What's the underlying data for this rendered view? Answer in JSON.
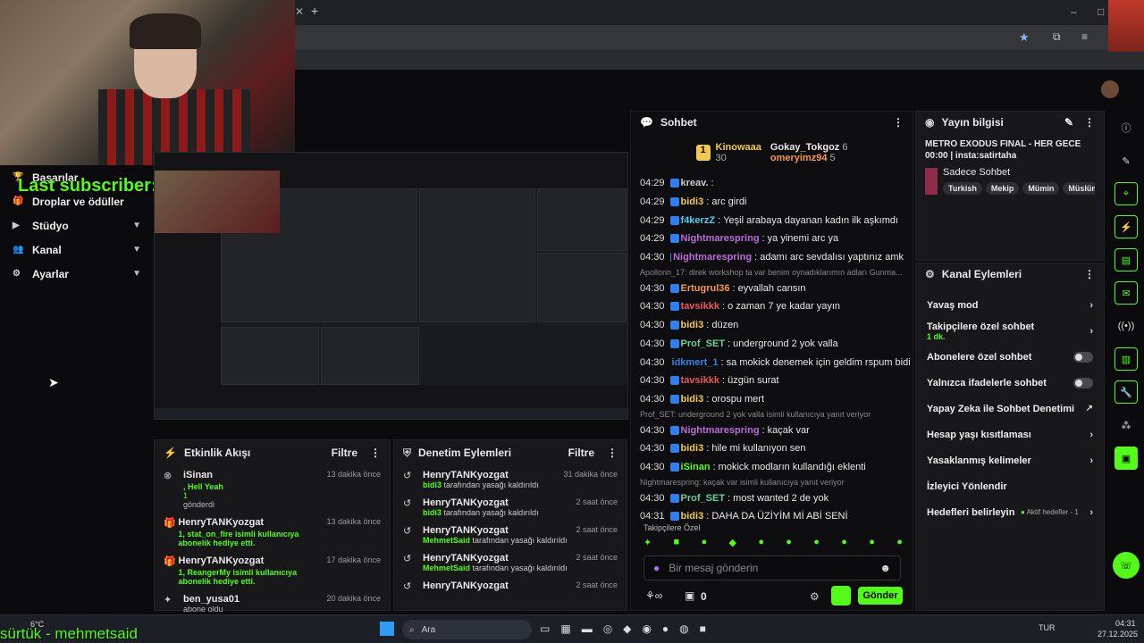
{
  "browser": {
    "new_tab": "+"
  },
  "overlay": {
    "last_subscriber": "Last subscriber: topaipanda",
    "bottom_user": "sürtük - mehmetsaid"
  },
  "leftnav": {
    "items": [
      {
        "label": "Başarılar",
        "icon": "trophy-icon",
        "chev": false
      },
      {
        "label": "Droplar ve ödüller",
        "icon": "gift-icon",
        "chev": false
      },
      {
        "label": "Stüdyo",
        "icon": "video-icon",
        "chev": true
      },
      {
        "label": "Kanal",
        "icon": "users-icon",
        "chev": true
      },
      {
        "label": "Ayarlar",
        "icon": "gear-icon",
        "chev": true
      }
    ]
  },
  "activity": {
    "title": "Etkinlik Akışı",
    "filter": "Filtre",
    "items": [
      {
        "name": "iSinan",
        "sub": ", Hell Yeah",
        "extra": "1",
        "note": "gönderdi",
        "time": "13 dakika önce",
        "icon": "kick-icon"
      },
      {
        "name": "HenryTANKyozgat",
        "sub": "1, stat_on_fire isimli kullanıcıya abonelik hediye etti.",
        "time": "13 dakika önce",
        "icon": "gift-icon"
      },
      {
        "name": "HenryTANKyozgat",
        "sub": "1, ReangerMy isimli kullanıcıya abonelik hediye etti.",
        "time": "17 dakika önce",
        "icon": "gift-icon"
      },
      {
        "name": "ben_yusa01",
        "sub": "abone oldu",
        "time": "20 dakika önce",
        "icon": "star-icon"
      }
    ]
  },
  "moderation": {
    "title": "Denetim Eylemleri",
    "filter": "Filtre",
    "items": [
      {
        "name": "HenryTANKyozgat",
        "actor": "bidi3",
        "text": "tarafından yasağı kaldırıldı",
        "time": "31 dakika önce"
      },
      {
        "name": "HenryTANKyozgat",
        "actor": "bidi3",
        "text": "tarafından yasağı kaldırıldı",
        "time": "2 saat önce"
      },
      {
        "name": "HenryTANKyozgat",
        "actor": "MehmetSaid",
        "text": "tarafından yasağı kaldırıldı",
        "time": "2 saat önce"
      },
      {
        "name": "HenryTANKyozgat",
        "actor": "MehmetSaid",
        "text": "tarafından yasağı kaldırıldı",
        "time": "2 saat önce"
      },
      {
        "name": "HenryTANKyozgat",
        "actor": "",
        "text": "",
        "time": "2 saat önce"
      }
    ]
  },
  "chat": {
    "title": "Sohbet",
    "leaders": [
      {
        "name": "Kinowaaa",
        "count": "30",
        "color": "#f2c94c"
      },
      {
        "name": "Gokay_Tokgoz",
        "count": "6",
        "color": "#ffffff"
      },
      {
        "name": "omeryimz94",
        "count": "5",
        "color": "#f2994a"
      }
    ],
    "messages": [
      {
        "t": "04:29",
        "u": "kreav.",
        "c": "#ccc",
        "m": ""
      },
      {
        "t": "04:29",
        "u": "bidi3",
        "c": "#f2c94c",
        "m": "arc girdi"
      },
      {
        "t": "04:29",
        "u": "f4kerzZ",
        "c": "#56ccf2",
        "m": "Yeşil arabaya dayanan kadın ilk aşkımdı"
      },
      {
        "t": "04:29",
        "u": "Nightmarespring",
        "c": "#bb6bd9",
        "m": "ya yinemi arc ya"
      },
      {
        "t": "04:30",
        "u": "Nightmarespring",
        "c": "#bb6bd9",
        "m": "adamı arc sevdalısı yaptınız amk"
      },
      {
        "sys": "Apollonn_17: direk workshop ta var benim oynadıklarımın adları Gunma..."
      },
      {
        "t": "04:30",
        "u": "Ertugrul36",
        "c": "#f2994a",
        "m": "eyvallah cansın"
      },
      {
        "t": "04:30",
        "u": "tavsikkk",
        "c": "#eb5757",
        "m": "o zaman 7 ye kadar yayın"
      },
      {
        "t": "04:30",
        "u": "bidi3",
        "c": "#f2c94c",
        "m": "düzen"
      },
      {
        "t": "04:30",
        "u": "Prof_SET",
        "c": "#6fcf97",
        "m": "underground 2 yok valla"
      },
      {
        "t": "04:30",
        "u": "idkmert_1",
        "c": "#2f80ed",
        "m": "sa mokick denemek için geldim rspum bidi"
      },
      {
        "t": "04:30",
        "u": "tavsikkk",
        "c": "#eb5757",
        "m": "üzgün surat"
      },
      {
        "t": "04:30",
        "u": "bidi3",
        "c": "#f2c94c",
        "m": "orospu mert"
      },
      {
        "sys": "Prof_SET: underground 2 yok valla isimli kullanıcıya yanıt veriyor"
      },
      {
        "t": "04:30",
        "u": "Nightmarespring",
        "c": "#bb6bd9",
        "m": "kaçak var"
      },
      {
        "t": "04:30",
        "u": "bidi3",
        "c": "#f2c94c",
        "m": "hile mi kullanıyon sen"
      },
      {
        "t": "04:30",
        "u": "iSinan",
        "c": "#53fc18",
        "m": "mokick modların kullandığı eklenti"
      },
      {
        "sys": "Nightmarespring: kaçak var isimli kullanıcıya yanıt veriyor"
      },
      {
        "t": "04:30",
        "u": "Prof_SET",
        "c": "#6fcf97",
        "m": "most wanted 2 de yok"
      },
      {
        "t": "04:31",
        "u": "bidi3",
        "c": "#f2c94c",
        "m": "DAHA DA ÜZİYİM Mİ ABİ SENİ"
      }
    ],
    "follower_label": "Takipçilere Özel",
    "input_placeholder": "Bir mesaj gönderin",
    "count": "0",
    "send": "Gönder"
  },
  "stream_info": {
    "title": "Yayın bilgisi",
    "stream_title": "METRO EXODUS FINAL - HER GECE 00:00 | insta:satirtaha",
    "category": "Sadece Sohbet",
    "tags": [
      "Turkish",
      "Mekip",
      "Mümin",
      "Müslüm"
    ]
  },
  "channel_actions": {
    "title": "Kanal Eylemleri",
    "items": [
      {
        "label": "Yavaş mod",
        "kind": "arrow"
      },
      {
        "label": "Takipçilere özel sohbet",
        "sub": "1 dk.",
        "kind": "arrow"
      },
      {
        "label": "Abonelere özel sohbet",
        "kind": "toggle"
      },
      {
        "label": "Yalnızca ifadelerle sohbet",
        "kind": "toggle"
      },
      {
        "label": "Yapay Zeka ile Sohbet Denetimi",
        "kind": "ext"
      },
      {
        "label": "Hesap yaşı kısıtlaması",
        "kind": "arrow"
      },
      {
        "label": "Yasaklanmış kelimeler",
        "kind": "arrow"
      },
      {
        "label": "İzleyici Yönlendir",
        "kind": "none"
      },
      {
        "label": "Hedefleri belirleyin",
        "extra": "Aktif hedefler - 1",
        "kind": "arrow"
      }
    ]
  },
  "taskbar": {
    "weather": "6°C",
    "search": "Ara",
    "lang": "TUR",
    "time": "04:31",
    "date": "27.12.2025"
  },
  "colors": {
    "accent": "#53fc18",
    "bg": "#0b0b0d",
    "panel": "#18181b"
  }
}
